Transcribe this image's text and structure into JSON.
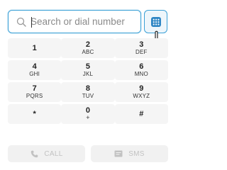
{
  "search": {
    "placeholder": "Search or dial number",
    "value": ""
  },
  "keypad_toggle": {
    "icon": "keypad-grid-icon",
    "color": "#2f86c4"
  },
  "keys": [
    [
      {
        "digit": "1",
        "letters": ""
      },
      {
        "digit": "2",
        "letters": "ABC"
      },
      {
        "digit": "3",
        "letters": "DEF"
      }
    ],
    [
      {
        "digit": "4",
        "letters": "GHI"
      },
      {
        "digit": "5",
        "letters": "JKL"
      },
      {
        "digit": "6",
        "letters": "MNO"
      }
    ],
    [
      {
        "digit": "7",
        "letters": "PQRS"
      },
      {
        "digit": "8",
        "letters": "TUV"
      },
      {
        "digit": "9",
        "letters": "WXYZ"
      }
    ],
    [
      {
        "digit": "*",
        "letters": ""
      },
      {
        "digit": "0",
        "letters": "+"
      },
      {
        "digit": "#",
        "letters": ""
      }
    ]
  ],
  "actions": {
    "call": {
      "label": "CALL",
      "icon": "phone-icon"
    },
    "sms": {
      "label": "SMS",
      "icon": "message-icon"
    }
  },
  "colors": {
    "accent": "#3aa0d6",
    "key_bg": "#f5f5f5",
    "disabled_text": "#c2c2c2"
  }
}
